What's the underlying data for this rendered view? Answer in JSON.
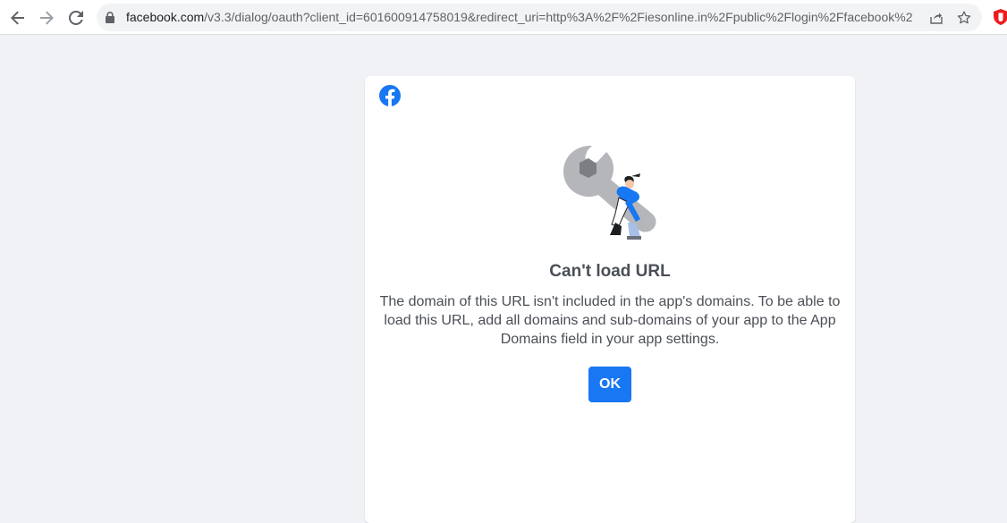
{
  "browser": {
    "url_host": "facebook.com",
    "url_path": "/v3.3/dialog/oauth?client_id=601600914758019&redirect_uri=http%3A%2F%2Fiesonline.in%2Fpublic%2Flogin%2Ffacebook%2F...",
    "icons": {
      "back": "back-arrow-icon",
      "forward": "forward-arrow-icon",
      "reload": "reload-icon",
      "lock": "lock-icon",
      "share": "share-icon",
      "bookmark": "star-icon",
      "extension": "extension-shield-icon"
    }
  },
  "dialog": {
    "logo": "facebook-logo-icon",
    "illustration": "wrench-mechanic-illustration",
    "title": "Can't load URL",
    "message": "The domain of this URL isn't included in the app's domains. To be able to load this URL, add all domains and sub-domains of your app to the App Domains field in your app settings.",
    "ok_label": "OK"
  },
  "colors": {
    "page_background": "#f0f2f5",
    "card_background": "#ffffff",
    "primary_button": "#1877f2",
    "text": "#4b4f56",
    "facebook_blue": "#1877f2"
  }
}
